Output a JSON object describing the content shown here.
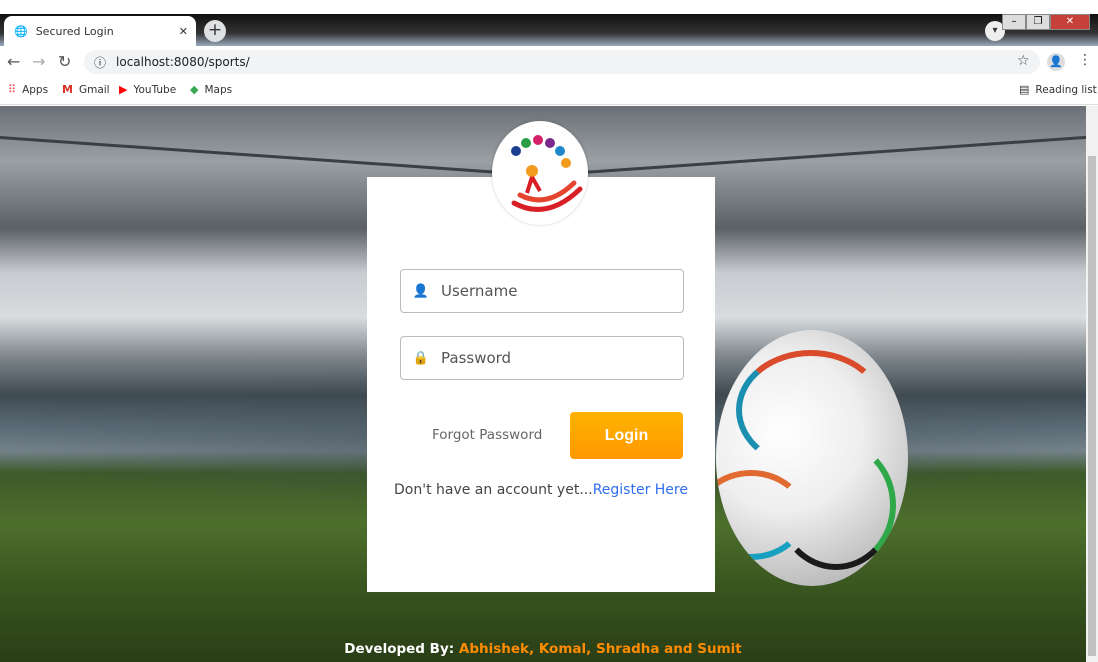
{
  "browser": {
    "tab_title": "Secured Login",
    "tab_close": "✕",
    "new_tab": "+",
    "url": "localhost:8080/sports/",
    "bookmarks": [
      {
        "label": "Apps",
        "icon": "apps-grid-icon"
      },
      {
        "label": "Gmail",
        "icon": "gmail-icon"
      },
      {
        "label": "YouTube",
        "icon": "youtube-icon"
      },
      {
        "label": "Maps",
        "icon": "maps-icon"
      }
    ],
    "reading_list": "Reading list"
  },
  "login": {
    "username_placeholder": "Username",
    "password_placeholder": "Password",
    "forgot_label": "Forgot Password",
    "login_label": "Login",
    "register_prompt": "Don't have an account yet...",
    "register_link": "Register Here"
  },
  "footer": {
    "prefix": "Developed By:",
    "names": "Abhishek, Komal, Shradha and Sumit"
  },
  "colors": {
    "accent": "#ff9800",
    "link": "#2f6ff0",
    "footer_names": "#ff8c00"
  }
}
